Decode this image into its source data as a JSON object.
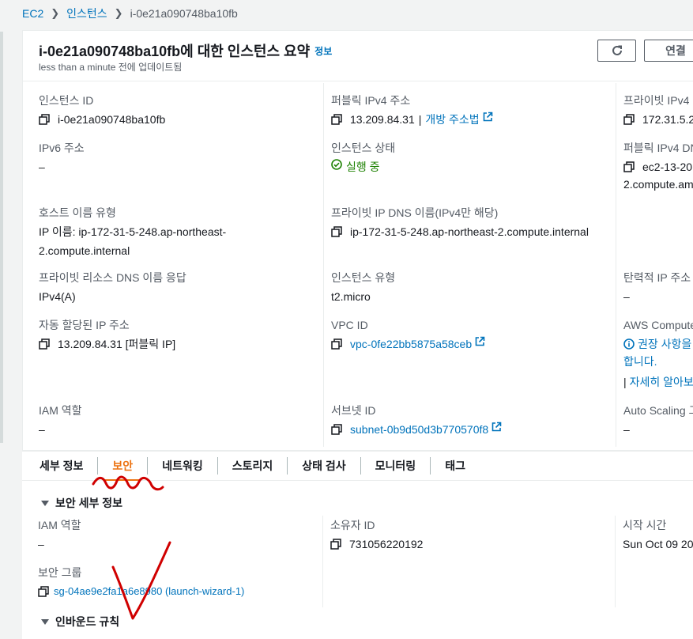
{
  "breadcrumb": {
    "root": "EC2",
    "parent": "인스턴스",
    "current": "i-0e21a090748ba10fb"
  },
  "header": {
    "title": "i-0e21a090748ba10fb에 대한 인스턴스 요약",
    "info_link": "정보",
    "updated": "less than a minute 전에 업데이트됨",
    "connect_label": "연결"
  },
  "summary": {
    "instance_id": {
      "label": "인스턴스 ID",
      "value": "i-0e21a090748ba10fb"
    },
    "public_ipv4": {
      "label": "퍼블릭 IPv4 주소",
      "value": "13.209.84.31",
      "sep": "|",
      "link": "개방 주소법"
    },
    "private_ipv4": {
      "label": "프라이빗 IPv4",
      "value": "172.31.5.2"
    },
    "ipv6": {
      "label": "IPv6 주소",
      "value": "–"
    },
    "instance_state": {
      "label": "인스턴스 상태",
      "value": "실행 중"
    },
    "public_dns": {
      "label": "퍼블릭 IPv4 DN",
      "value_line1": "ec2-13-20",
      "value_line2": "2.compute.am"
    },
    "hostname_type": {
      "label": "호스트 이름 유형",
      "value_line1": "IP 이름: ip-172-31-5-248.ap-northeast-",
      "value_line2": "2.compute.internal"
    },
    "private_dns": {
      "label": "프라이빗 IP DNS 이름(IPv4만 해당)",
      "value": "ip-172-31-5-248.ap-northeast-2.compute.internal"
    },
    "elastic_ip": {
      "label": "탄력적 IP 주소",
      "value": "–"
    },
    "private_resource_dns": {
      "label": "프라이빗 리소스 DNS 이름 응답",
      "value": "IPv4(A)"
    },
    "instance_type": {
      "label": "인스턴스 유형",
      "value": "t2.micro"
    },
    "auto_ip": {
      "label": "자동 할당된 IP 주소",
      "value": "13.209.84.31 [퍼블릭 IP]"
    },
    "vpc_id": {
      "label": "VPC ID",
      "value": "vpc-0fe22bb5875a58ceb"
    },
    "compute_optimizer": {
      "label": "AWS Compute",
      "value_line1": "권장 사항을",
      "value_line2": "합니다.",
      "link": "자세히 알아보"
    },
    "iam_role": {
      "label": "IAM 역할",
      "value": "–"
    },
    "subnet_id": {
      "label": "서브넷 ID",
      "value": "subnet-0b9d50d3b770570f8"
    },
    "auto_scaling": {
      "label": "Auto Scaling 그",
      "value": "–"
    }
  },
  "tabs": [
    {
      "label": "세부 정보",
      "active": false
    },
    {
      "label": "보안",
      "active": true
    },
    {
      "label": "네트워킹",
      "active": false
    },
    {
      "label": "스토리지",
      "active": false
    },
    {
      "label": "상태 검사",
      "active": false
    },
    {
      "label": "모니터링",
      "active": false
    },
    {
      "label": "태그",
      "active": false
    }
  ],
  "security": {
    "section_title": "보안 세부 정보",
    "iam_role": {
      "label": "IAM 역할",
      "value": "–"
    },
    "owner_id": {
      "label": "소유자 ID",
      "value": "731056220192"
    },
    "launch_time": {
      "label": "시작 시간",
      "value": "Sun Oct 09 20"
    },
    "security_groups": {
      "label": "보안 그룹",
      "value": "sg-04ae9e2fa1a6e8980 (launch-wizard-1)"
    },
    "inbound_title": "인바운드 규칙"
  },
  "colors": {
    "accent": "#ec7211",
    "link": "#0073bb",
    "success": "#1d8102",
    "annotation": "#d00000"
  }
}
